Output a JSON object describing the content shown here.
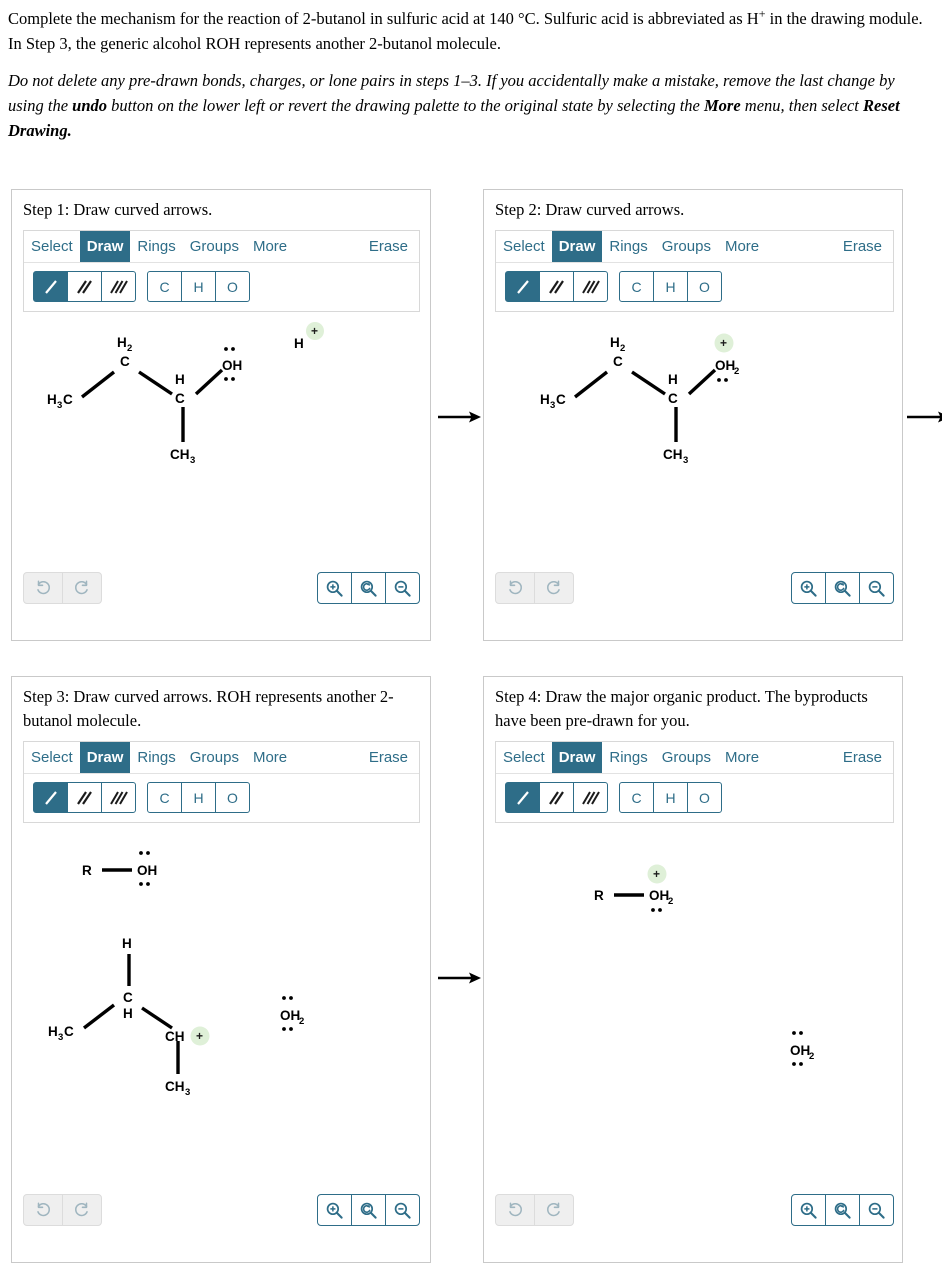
{
  "prompt": {
    "line1_a": "Complete the mechanism for the reaction of 2-butanol in sulfuric acid at 140 °C. Sulfuric acid is abbreviated as H",
    "line1_charge": "+",
    "line1_b": " in the drawing module. In Step 3, the generic alcohol ROH represents another 2-butanol molecule.",
    "line2_a": "Do not delete any pre-drawn bonds, charges, or lone pairs in steps 1–3. If you accidentally make a mistake, remove the last change by using the ",
    "line2_bold1": "undo",
    "line2_b": " button on the lower left or revert the drawing palette to the original state by selecting the ",
    "line2_bold2": "More",
    "line2_c": " menu, then select ",
    "line2_bold3": "Reset Drawing."
  },
  "colors": {
    "accent": "#2e6d88",
    "panel_border": "#c9c9c9",
    "charge_halo": "#dff0d8",
    "disabled_btn_bg": "#efefef"
  },
  "toolbar": {
    "menu": [
      "Select",
      "Draw",
      "Rings",
      "Groups",
      "More"
    ],
    "active_menu": "Draw",
    "erase_label": "Erase",
    "bond_buttons": [
      {
        "name": "single-bond",
        "selected": true
      },
      {
        "name": "double-bond",
        "selected": false
      },
      {
        "name": "triple-bond",
        "selected": false
      }
    ],
    "element_buttons": [
      "C",
      "H",
      "O"
    ],
    "history_buttons": [
      "undo",
      "redo"
    ],
    "zoom_buttons": [
      "zoom-in",
      "zoom-reset",
      "zoom-out"
    ]
  },
  "panels": [
    {
      "id": "step1",
      "title": "Step 1: Draw curved arrows.",
      "molecules": {
        "butanol": {
          "h3c": "H",
          "h3c_sub": "3",
          "h3c_c": "C",
          "ch2_label": "H",
          "ch2_sub": "2",
          "ch2_c": "C",
          "ch_h": "H",
          "ch_c": "C",
          "ch3": "CH",
          "ch3_sub": "3",
          "oh": "OH"
        },
        "proton": {
          "label": "H",
          "charge": "+"
        }
      }
    },
    {
      "id": "step2",
      "title": "Step 2: Draw curved arrows.",
      "molecules": {
        "protonated": {
          "h3c": "H",
          "h3c_sub": "3",
          "h3c_c": "C",
          "ch2_label": "H",
          "ch2_sub": "2",
          "ch2_c": "C",
          "ch_h": "H",
          "ch_c": "C",
          "ch3": "CH",
          "ch3_sub": "3",
          "oh2": "OH",
          "oh2_sub": "2",
          "charge": "+"
        }
      }
    },
    {
      "id": "step3",
      "title": "Step 3: Draw curved arrows. ROH represents another 2-butanol molecule.",
      "molecules": {
        "roh": {
          "r": "R",
          "oh": "OH"
        },
        "carbocation": {
          "h_top": "H",
          "h3c": "H",
          "h3c_sub": "3",
          "h3c_c": "C",
          "c_label": "C",
          "c_h": "H",
          "ch": "CH",
          "charge": "+",
          "ch3": "CH",
          "ch3_sub": "3"
        },
        "water": {
          "label": "OH",
          "sub": "2"
        }
      }
    },
    {
      "id": "step4",
      "title": "Step 4: Draw the major organic product. The byproducts have been pre-drawn for you.",
      "molecules": {
        "roh2": {
          "r": "R",
          "oh2": "OH",
          "sub": "2",
          "charge": "+"
        },
        "water": {
          "label": "OH",
          "sub": "2"
        }
      }
    }
  ],
  "reaction_arrows": [
    {
      "name": "arrow-step1-to-step2"
    },
    {
      "name": "arrow-step2-to-step3"
    },
    {
      "name": "arrow-step3-to-step4"
    }
  ]
}
